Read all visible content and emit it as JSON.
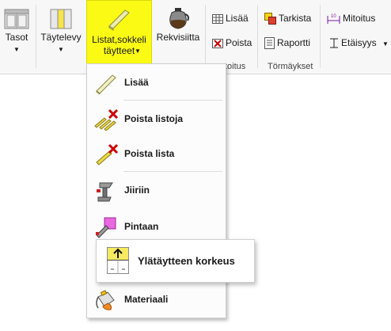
{
  "ribbon": {
    "buttons": {
      "tasot": "Tasot",
      "taytelevy": "Täytelevy",
      "listat_line1": "Listat,sokkeli",
      "listat_line2": "täytteet",
      "rekvisiitta": "Rekvisiitta"
    },
    "groups": {
      "lisaa": "Lisää",
      "poista": "Poista",
      "mitoitus_partial": "toitus",
      "tarkista": "Tarkista",
      "raportti": "Raportti",
      "tormaykset": "Törmäykset",
      "mitoitus": "Mitoitus",
      "etaisyys": "Etäisyys"
    }
  },
  "menu": {
    "items": [
      {
        "label": "Lisää",
        "icon": "beam-add-icon"
      },
      {
        "label": "Poista listoja",
        "icon": "beams-delete-icon"
      },
      {
        "label": "Poista lista",
        "icon": "beam-delete-icon"
      },
      {
        "label": "Jiiriin",
        "icon": "miter-icon"
      },
      {
        "label": "Pintaan",
        "icon": "to-surface-icon"
      },
      {
        "label": "Materiaali",
        "icon": "material-bucket-icon"
      }
    ]
  },
  "tooltip": {
    "label": "Ylätäytteen korkeus",
    "icon": "top-filler-height-icon"
  },
  "colors": {
    "active_button": "#fafa14",
    "menu_background": "#fcfcfc",
    "delete_mark": "#cc0000",
    "beam_yellow": "#e8d84a"
  }
}
